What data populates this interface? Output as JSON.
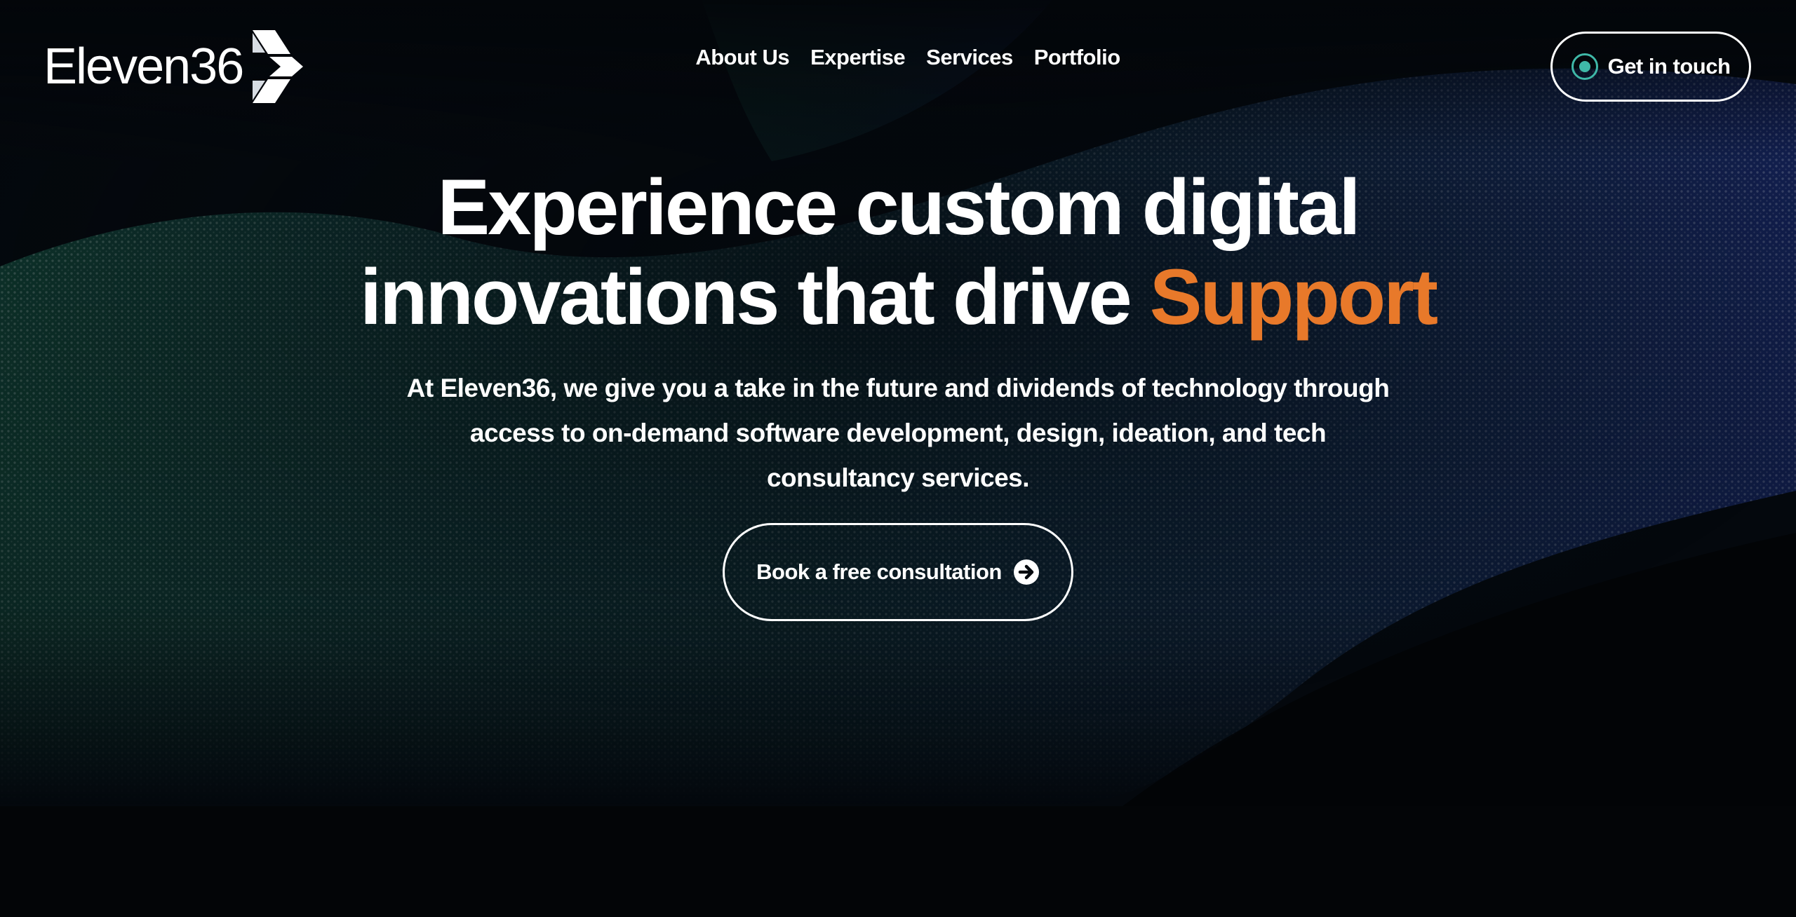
{
  "header": {
    "logo_text": "Eleven36",
    "nav": [
      {
        "label": "About Us"
      },
      {
        "label": "Expertise"
      },
      {
        "label": "Services"
      },
      {
        "label": "Portfolio"
      }
    ],
    "cta_label": "Get in touch"
  },
  "hero": {
    "headline_line1": "Experience custom digital",
    "headline_line2": "innovations that drive ",
    "headline_accent": "Support",
    "subtext_line1": "At Eleven36, we give you a take in the future and dividends of technology through",
    "subtext_line2": "access to on-demand software development, design, ideation, and tech",
    "subtext_line3": "consultancy services.",
    "cta_label": "Book a free consultation"
  },
  "colors": {
    "background": "#030507",
    "accent_orange": "#e8792a",
    "accent_teal": "#3fb8a8",
    "wave_green": "#1f7a5c",
    "wave_blue": "#2a45b8"
  },
  "icons": {
    "logo_mark": "chevron-stack-icon",
    "cta_dot": "radio-dot-icon",
    "cta_arrow": "arrow-right-circle-icon"
  }
}
